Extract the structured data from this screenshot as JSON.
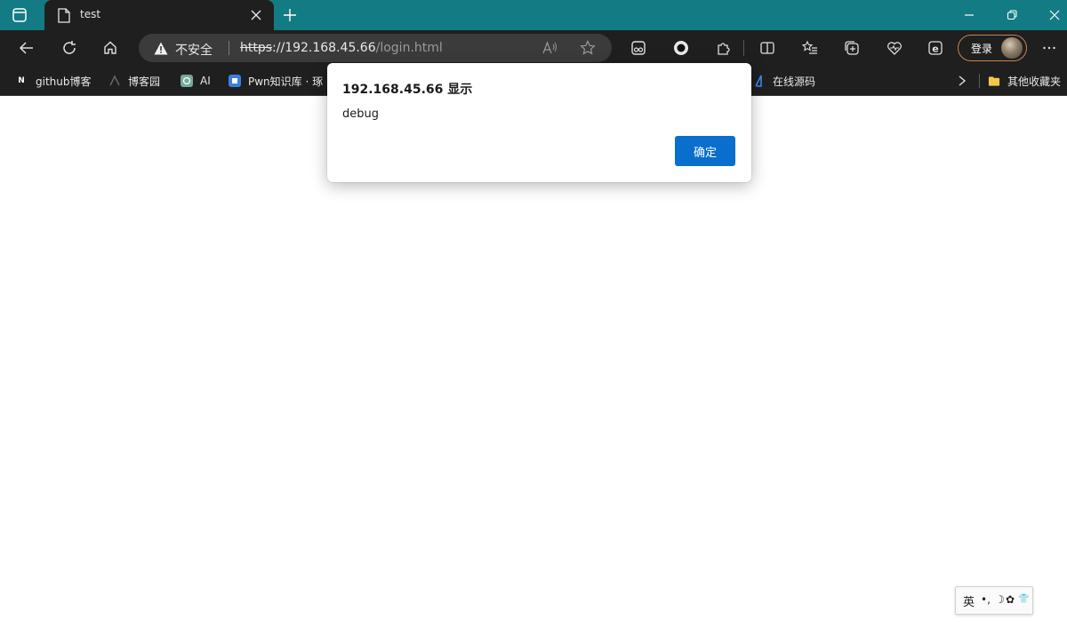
{
  "tab": {
    "title": "test"
  },
  "address_bar": {
    "security_label": "不安全",
    "url_scheme": "https",
    "url_host": "://192.168.45.66",
    "url_path": "/login.html"
  },
  "profile": {
    "login_label": "登录"
  },
  "bookmarks": [
    {
      "label": "github博客",
      "icon": "N"
    },
    {
      "label": "博客园",
      "icon": "cnblogs-icon"
    },
    {
      "label": "AI",
      "icon": "openai-icon"
    },
    {
      "label": "Pwn知识库 · 琢",
      "icon": "book-icon"
    },
    {
      "label": "在线源码",
      "icon": "code-icon"
    }
  ],
  "bookmarks_more": "其他收藏夹",
  "dialog": {
    "title": "192.168.45.66 显示",
    "message": "debug",
    "ok_label": "确定"
  },
  "ime": {
    "mode": "英",
    "punct": "•,",
    "moon": "☽",
    "gear": "✿",
    "shirt": "👕"
  },
  "colors": {
    "titlebar": "#137b83",
    "toolbar": "#1f1f1f",
    "accent": "#0a6fcc",
    "profile_border": "#c9824b"
  }
}
